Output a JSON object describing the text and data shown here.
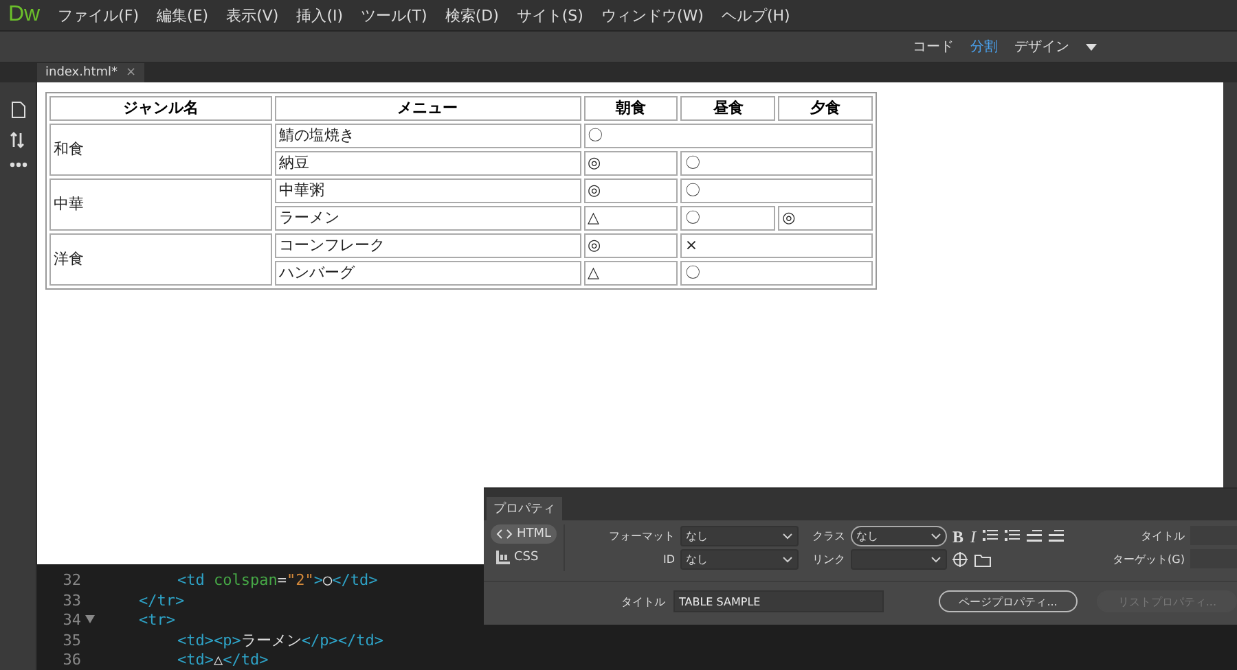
{
  "app": {
    "logo": "Dw"
  },
  "menu": [
    "ファイル(F)",
    "編集(E)",
    "表示(V)",
    "挿入(I)",
    "ツール(T)",
    "検索(D)",
    "サイト(S)",
    "ウィンドウ(W)",
    "ヘルプ(H)"
  ],
  "view_switch": [
    {
      "label": "コード",
      "selected": false
    },
    {
      "label": "分割",
      "selected": true
    },
    {
      "label": "デザイン",
      "selected": false
    }
  ],
  "document_tab": {
    "label": "index.html*",
    "close": "×"
  },
  "table": {
    "columns": [
      "ジャンル名",
      "メニュー",
      "朝食",
      "昼食",
      "夕食"
    ],
    "groups": [
      {
        "genre": "和食",
        "rows": [
          {
            "menu": "鯖の塩焼き",
            "cells": [
              {
                "text": "〇",
                "colspan": 3
              }
            ]
          },
          {
            "menu": "納豆",
            "cells": [
              {
                "text": "◎"
              },
              {
                "text": "〇",
                "colspan": 2
              }
            ]
          }
        ]
      },
      {
        "genre": "中華",
        "rows": [
          {
            "menu": "中華粥",
            "cells": [
              {
                "text": "◎"
              },
              {
                "text": "〇",
                "colspan": 2
              }
            ]
          },
          {
            "menu": "ラーメン",
            "cells": [
              {
                "text": "△"
              },
              {
                "text": "〇"
              },
              {
                "text": "◎"
              }
            ]
          }
        ]
      },
      {
        "genre": "洋食",
        "rows": [
          {
            "menu": "コーンフレーク",
            "cells": [
              {
                "text": "◎"
              },
              {
                "text": "×",
                "colspan": 2
              }
            ]
          },
          {
            "menu": "ハンバーグ",
            "cells": [
              {
                "text": "△"
              },
              {
                "text": "〇",
                "colspan": 2
              }
            ]
          }
        ]
      }
    ]
  },
  "code_lines": [
    {
      "number": "32",
      "kind": "cell",
      "folded": false,
      "tokens": [
        {
          "kind": "tag",
          "text": "<td"
        },
        {
          "kind": "attr",
          "text": " colspan"
        },
        {
          "kind": "text",
          "text": "="
        },
        {
          "kind": "value",
          "text": "\"2\""
        },
        {
          "kind": "tag",
          "text": ">"
        },
        {
          "kind": "text",
          "text": "○"
        },
        {
          "kind": "tag",
          "text": "</td>"
        }
      ]
    },
    {
      "number": "33",
      "kind": "row",
      "folded": false,
      "tokens": [
        {
          "kind": "tag",
          "text": "</tr>"
        }
      ]
    },
    {
      "number": "34",
      "kind": "row",
      "folded": true,
      "tokens": [
        {
          "kind": "tag",
          "text": "<tr>"
        }
      ]
    },
    {
      "number": "35",
      "kind": "cell",
      "folded": false,
      "tokens": [
        {
          "kind": "tag",
          "text": "<td><p>"
        },
        {
          "kind": "text",
          "text": "ラーメン"
        },
        {
          "kind": "tag",
          "text": "</p></td>"
        }
      ]
    },
    {
      "number": "36",
      "kind": "cell",
      "folded": false,
      "tokens": [
        {
          "kind": "tag",
          "text": "<td>"
        },
        {
          "kind": "text",
          "text": "△"
        },
        {
          "kind": "tag",
          "text": "</td>"
        }
      ]
    }
  ],
  "properties": {
    "tab": "プロパティ",
    "modes": [
      {
        "label": "HTML",
        "selected": true
      },
      {
        "label": "CSS",
        "selected": false
      }
    ],
    "format": {
      "label": "フォーマット",
      "value": "なし"
    },
    "id": {
      "label": "ID",
      "value": "なし"
    },
    "class": {
      "label": "クラス",
      "value": "なし"
    },
    "bold": "B",
    "italic": "I",
    "link": {
      "label": "リンク"
    },
    "right_labels": [
      "タイトル",
      "ターゲット(G)"
    ],
    "title": {
      "label": "タイトル",
      "value": "TABLE SAMPLE"
    },
    "buttons": [
      {
        "label": "ページプロパティ...",
        "disabled": false
      },
      {
        "label": "リストプロパティ...",
        "disabled": true
      }
    ]
  }
}
